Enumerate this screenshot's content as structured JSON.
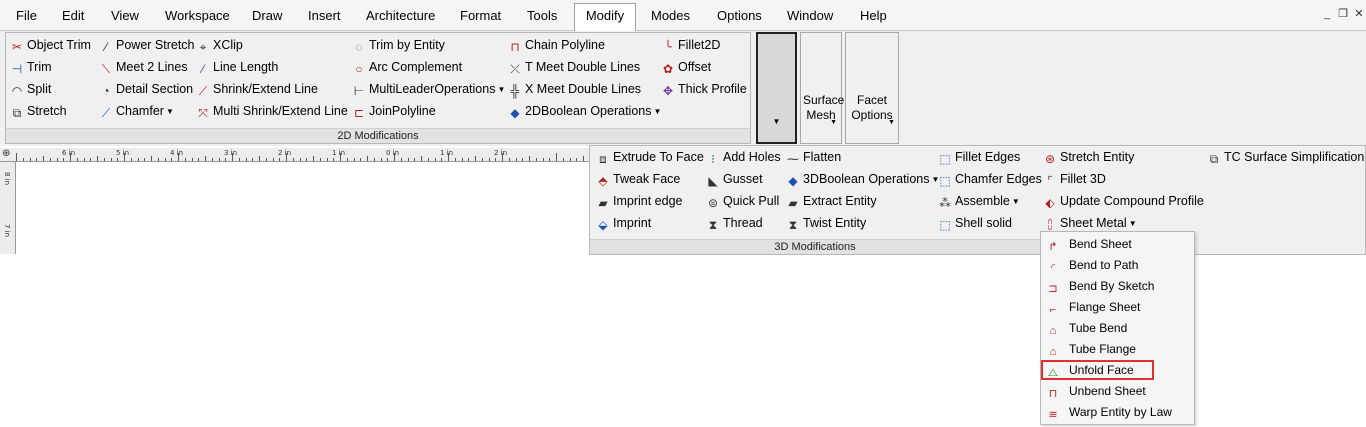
{
  "menubar": {
    "items": [
      "File",
      "Edit",
      "View",
      "Workspace",
      "Draw",
      "Insert",
      "Architecture",
      "Format",
      "Tools",
      "Modify",
      "Modes",
      "Options",
      "Window",
      "Help"
    ],
    "active": "Modify"
  },
  "ribbon": {
    "panel_2d_label": "2D Modifications",
    "panel_3d_label": "3D Modifications",
    "tools_2d": {
      "object_trim": "Object Trim",
      "trim": "Trim",
      "split": "Split",
      "stretch": "Stretch",
      "power_stretch": "Power Stretch",
      "meet_2_lines": "Meet 2 Lines",
      "detail_section": "Detail Section",
      "chamfer": "Chamfer",
      "xclip": "XClip",
      "line_length": "Line Length",
      "shrink_extend_line": "Shrink/Extend Line",
      "multi_shrink_extend_line": "Multi Shrink/Extend Line",
      "trim_by_entity": "Trim by Entity",
      "arc_complement": "Arc Complement",
      "multileader_operations": "MultiLeaderOperations",
      "join_polyline": "JoinPolyline",
      "chain_polyline": "Chain Polyline",
      "t_meet_double_lines": "T Meet Double Lines",
      "x_meet_double_lines": "X Meet Double Lines",
      "boolean_2d_operations": "2DBoolean Operations",
      "fillet2d": "Fillet2D",
      "offset": "Offset",
      "thick_profile": "Thick Profile"
    },
    "surface_mesh": "Surface Mesh",
    "facet_options": "Facet Options",
    "tools_3d": {
      "extrude_to_face": "Extrude To Face",
      "tweak_face": "Tweak Face",
      "imprint_edge": "Imprint edge",
      "imprint": "Imprint",
      "add_holes": "Add Holes",
      "gusset": "Gusset",
      "quick_pull": "Quick Pull",
      "thread": "Thread",
      "flatten": "Flatten",
      "boolean_3d_operations": "3DBoolean Operations",
      "extract_entity": "Extract Entity",
      "twist_entity": "Twist Entity",
      "fillet_edges": "Fillet Edges",
      "chamfer_edges": "Chamfer Edges",
      "assemble": "Assemble",
      "shell_solid": "Shell solid",
      "stretch_entity": "Stretch Entity",
      "fillet_3d": "Fillet 3D",
      "update_compound_profile": "Update Compound Profile",
      "sheet_metal": "Sheet Metal",
      "tc_surface_simplification": "TC Surface Simplification"
    }
  },
  "ruler": {
    "labels": [
      "6 in",
      "5 in",
      "4 in",
      "3 in",
      "2 in",
      "1 in",
      "0 in",
      "1 in",
      "2 in"
    ],
    "vlabels": [
      "8 in",
      "7 in"
    ]
  },
  "sheet_metal_menu": {
    "items": [
      "Bend Sheet",
      "Bend to Path",
      "Bend By Sketch",
      "Flange Sheet",
      "Tube Bend",
      "Tube Flange",
      "Unfold Face",
      "Unbend Sheet",
      "Warp Entity by Law"
    ],
    "highlighted": "Unfold Face"
  },
  "colors": {
    "highlight_border": "#e03030",
    "ribbon_bg": "#f0f0f0"
  }
}
